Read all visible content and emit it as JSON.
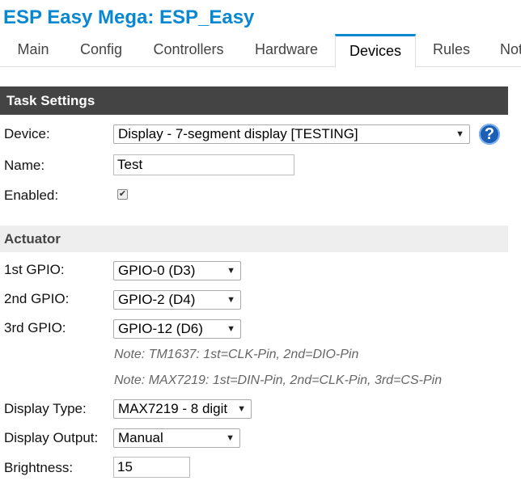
{
  "header": {
    "title": "ESP Easy Mega: ESP_Easy"
  },
  "tabs": [
    "Main",
    "Config",
    "Controllers",
    "Hardware",
    "Devices",
    "Rules",
    "Not"
  ],
  "task_settings": {
    "section_title": "Task Settings",
    "device_label": "Device:",
    "device_value": "Display - 7-segment display [TESTING]",
    "help_icon_glyph": "?",
    "name_label": "Name:",
    "name_value": "Test",
    "enabled_label": "Enabled:",
    "enabled_checked": true
  },
  "actuator": {
    "section_title": "Actuator",
    "gpio1_label": "1st GPIO:",
    "gpio1_value": "GPIO-0 (D3)",
    "gpio2_label": "2nd GPIO:",
    "gpio2_value": "GPIO-2 (D4)",
    "gpio3_label": "3rd GPIO:",
    "gpio3_value": "GPIO-12 (D6)",
    "note1": "Note: TM1637: 1st=CLK-Pin, 2nd=DIO-Pin",
    "note2": "Note: MAX7219: 1st=DIN-Pin, 2nd=CLK-Pin, 3rd=CS-Pin",
    "display_type_label": "Display Type:",
    "display_type_value": "MAX7219 - 8 digit",
    "display_output_label": "Display Output:",
    "display_output_value": "Manual",
    "brightness_label": "Brightness:",
    "brightness_value": "15"
  },
  "colors": {
    "accent": "#0788d0",
    "header_bar": "#444444",
    "subheader_bar": "#eeeeee"
  },
  "icons": {
    "select_arrow": "▼",
    "help": "help-icon",
    "check": "✔"
  }
}
